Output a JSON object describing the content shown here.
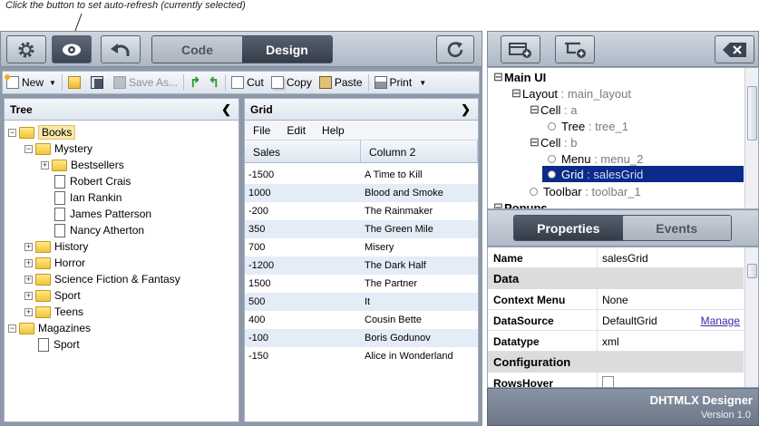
{
  "hint": "Click the button to set auto-refresh (currently selected)",
  "topbar": {
    "code_label": "Code",
    "design_label": "Design"
  },
  "toolbar": {
    "new": "New",
    "save_as": "Save As...",
    "cut": "Cut",
    "copy": "Copy",
    "paste": "Paste",
    "print": "Print"
  },
  "tree_panel": {
    "title": "Tree",
    "nodes": {
      "books": "Books",
      "mystery": "Mystery",
      "bestsellers": "Bestsellers",
      "robert": "Robert Crais",
      "ian": "Ian Rankin",
      "james": "James Patterson",
      "nancy": "Nancy Atherton",
      "history": "History",
      "horror": "Horror",
      "scifi": "Science Fiction & Fantasy",
      "sport": "Sport",
      "teens": "Teens",
      "magazines": "Magazines",
      "mag_sport": "Sport"
    }
  },
  "grid_panel": {
    "title": "Grid",
    "menu": {
      "file": "File",
      "edit": "Edit",
      "help": "Help"
    },
    "columns": {
      "c1": "Sales",
      "c2": "Column 2"
    },
    "rows": [
      {
        "sales": "-1500",
        "title": "A Time to Kill"
      },
      {
        "sales": "1000",
        "title": "Blood and Smoke"
      },
      {
        "sales": "-200",
        "title": "The Rainmaker"
      },
      {
        "sales": "350",
        "title": "The Green Mile"
      },
      {
        "sales": "700",
        "title": "Misery"
      },
      {
        "sales": "-1200",
        "title": "The Dark Half"
      },
      {
        "sales": "1500",
        "title": "The Partner"
      },
      {
        "sales": "500",
        "title": "It"
      },
      {
        "sales": "400",
        "title": "Cousin Bette"
      },
      {
        "sales": "-100",
        "title": "Boris Godunov"
      },
      {
        "sales": "-150",
        "title": "Alice in Wonderland"
      }
    ]
  },
  "structure": {
    "main_ui": "Main UI",
    "layout": {
      "name": "Layout",
      "id": "main_layout"
    },
    "cell_a": {
      "name": "Cell",
      "id": "a"
    },
    "tree": {
      "name": "Tree",
      "id": "tree_1"
    },
    "cell_b": {
      "name": "Cell",
      "id": "b"
    },
    "menu": {
      "name": "Menu",
      "id": "menu_2"
    },
    "grid": {
      "name": "Grid",
      "id": "salesGrid"
    },
    "toolbar": {
      "name": "Toolbar",
      "id": "toolbar_1"
    },
    "popups": "Popups"
  },
  "props_tabs": {
    "properties": "Properties",
    "events": "Events"
  },
  "properties": {
    "name_key": "Name",
    "name_val": "salesGrid",
    "group_data": "Data",
    "context_key": "Context Menu",
    "context_val": "None",
    "ds_key": "DataSource",
    "ds_val": "DefaultGrid",
    "ds_link": "Manage",
    "dt_key": "Datatype",
    "dt_val": "xml",
    "group_config": "Configuration",
    "rh_key": "RowsHover"
  },
  "brand": {
    "title": "DHTMLX Designer",
    "version": "Version 1.0"
  }
}
